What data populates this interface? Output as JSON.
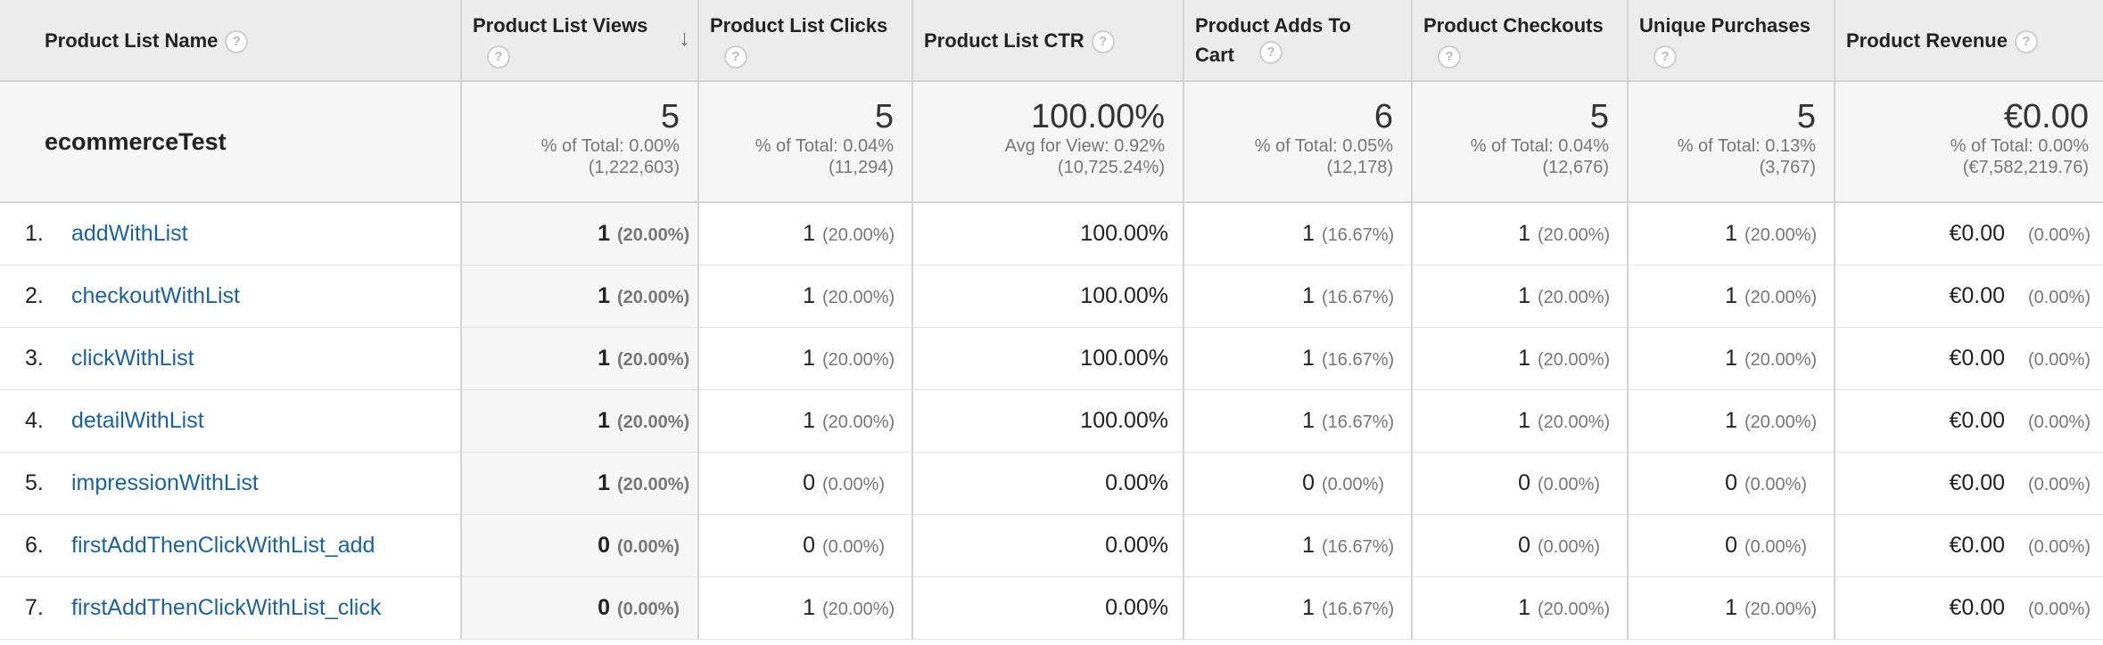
{
  "columns": [
    {
      "label": "Product List Name"
    },
    {
      "label": "Product List Views"
    },
    {
      "label": "Product List Clicks"
    },
    {
      "label": "Product List CTR"
    },
    {
      "label": "Product Adds To Cart"
    },
    {
      "label": "Product Checkouts"
    },
    {
      "label": "Unique Purchases"
    },
    {
      "label": "Product Revenue"
    }
  ],
  "help_glyph": "?",
  "sort_glyph": "↓",
  "totals": {
    "name": "ecommerceTest",
    "views": {
      "value": "5",
      "line1": "% of Total: 0.00%",
      "line2": "(1,222,603)"
    },
    "clicks": {
      "value": "5",
      "line1": "% of Total: 0.04%",
      "line2": "(11,294)"
    },
    "ctr": {
      "value": "100.00%",
      "line1": "Avg for View: 0.92%",
      "line2": "(10,725.24%)"
    },
    "adds": {
      "value": "6",
      "line1": "% of Total: 0.05%",
      "line2": "(12,178)"
    },
    "checkouts": {
      "value": "5",
      "line1": "% of Total: 0.04%",
      "line2": "(12,676)"
    },
    "purchases": {
      "value": "5",
      "line1": "% of Total: 0.13%",
      "line2": "(3,767)"
    },
    "revenue": {
      "value": "€0.00",
      "line1": "% of Total: 0.00%",
      "line2": "(€7,582,219.76)"
    }
  },
  "rows": [
    {
      "idx": "1.",
      "name": "addWithList",
      "views": "1",
      "views_pct": "(20.00%)",
      "clicks": "1",
      "clicks_pct": "(20.00%)",
      "ctr": "100.00%",
      "adds": "1",
      "adds_pct": "(16.67%)",
      "checkouts": "1",
      "checkouts_pct": "(20.00%)",
      "purchases": "1",
      "purchases_pct": "(20.00%)",
      "revenue": "€0.00",
      "revenue_pct": "(0.00%)"
    },
    {
      "idx": "2.",
      "name": "checkoutWithList",
      "views": "1",
      "views_pct": "(20.00%)",
      "clicks": "1",
      "clicks_pct": "(20.00%)",
      "ctr": "100.00%",
      "adds": "1",
      "adds_pct": "(16.67%)",
      "checkouts": "1",
      "checkouts_pct": "(20.00%)",
      "purchases": "1",
      "purchases_pct": "(20.00%)",
      "revenue": "€0.00",
      "revenue_pct": "(0.00%)"
    },
    {
      "idx": "3.",
      "name": "clickWithList",
      "views": "1",
      "views_pct": "(20.00%)",
      "clicks": "1",
      "clicks_pct": "(20.00%)",
      "ctr": "100.00%",
      "adds": "1",
      "adds_pct": "(16.67%)",
      "checkouts": "1",
      "checkouts_pct": "(20.00%)",
      "purchases": "1",
      "purchases_pct": "(20.00%)",
      "revenue": "€0.00",
      "revenue_pct": "(0.00%)"
    },
    {
      "idx": "4.",
      "name": "detailWithList",
      "views": "1",
      "views_pct": "(20.00%)",
      "clicks": "1",
      "clicks_pct": "(20.00%)",
      "ctr": "100.00%",
      "adds": "1",
      "adds_pct": "(16.67%)",
      "checkouts": "1",
      "checkouts_pct": "(20.00%)",
      "purchases": "1",
      "purchases_pct": "(20.00%)",
      "revenue": "€0.00",
      "revenue_pct": "(0.00%)"
    },
    {
      "idx": "5.",
      "name": "impressionWithList",
      "views": "1",
      "views_pct": "(20.00%)",
      "clicks": "0",
      "clicks_pct": "(0.00%)",
      "ctr": "0.00%",
      "adds": "0",
      "adds_pct": "(0.00%)",
      "checkouts": "0",
      "checkouts_pct": "(0.00%)",
      "purchases": "0",
      "purchases_pct": "(0.00%)",
      "revenue": "€0.00",
      "revenue_pct": "(0.00%)"
    },
    {
      "idx": "6.",
      "name": "firstAddThenClickWithList_add",
      "views": "0",
      "views_pct": "(0.00%)",
      "clicks": "0",
      "clicks_pct": "(0.00%)",
      "ctr": "0.00%",
      "adds": "1",
      "adds_pct": "(16.67%)",
      "checkouts": "0",
      "checkouts_pct": "(0.00%)",
      "purchases": "0",
      "purchases_pct": "(0.00%)",
      "revenue": "€0.00",
      "revenue_pct": "(0.00%)"
    },
    {
      "idx": "7.",
      "name": "firstAddThenClickWithList_click",
      "views": "0",
      "views_pct": "(0.00%)",
      "clicks": "1",
      "clicks_pct": "(20.00%)",
      "ctr": "0.00%",
      "adds": "1",
      "adds_pct": "(16.67%)",
      "checkouts": "1",
      "checkouts_pct": "(20.00%)",
      "purchases": "1",
      "purchases_pct": "(20.00%)",
      "revenue": "€0.00",
      "revenue_pct": "(0.00%)"
    }
  ]
}
